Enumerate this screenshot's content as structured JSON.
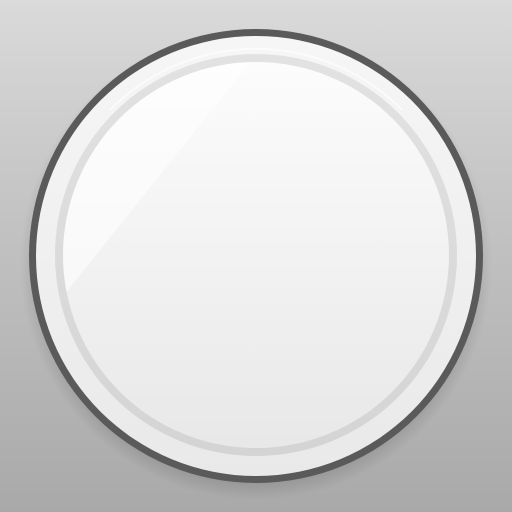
{
  "icon": {
    "name": "mirror-icon",
    "colors": {
      "background_top": "#dadada",
      "background_bottom": "#a9a9a9",
      "rim": "#5a5a5a",
      "bezel": "#f4f4f4",
      "glass_top": "#fdfdfd",
      "glass_bottom": "#e6e6e6"
    }
  }
}
